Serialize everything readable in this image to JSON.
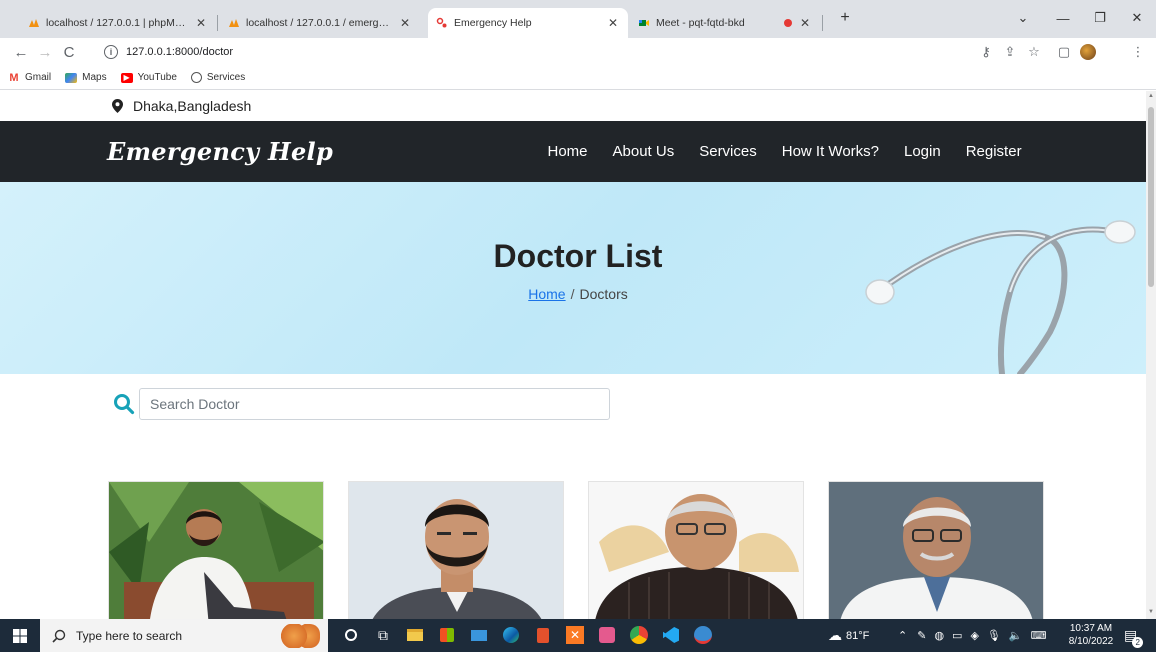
{
  "browser": {
    "tabs": [
      {
        "title": "localhost / 127.0.0.1 | phpMyAdmin",
        "active": false
      },
      {
        "title": "localhost / 127.0.0.1 / emergency",
        "active": false
      },
      {
        "title": "Emergency Help",
        "active": true
      },
      {
        "title": "Meet - pqt-fqtd-bkd",
        "active": false
      }
    ],
    "url": "127.0.0.1:8000/doctor",
    "bookmarks": [
      "Gmail",
      "Maps",
      "YouTube",
      "Services"
    ]
  },
  "page": {
    "location": "Dhaka,Bangladesh",
    "brand": "Emergency Help",
    "nav": [
      "Home",
      "About Us",
      "Services",
      "How It Works?",
      "Login",
      "Register"
    ],
    "hero": {
      "title": "Doctor List",
      "breadcrumb_home": "Home",
      "breadcrumb_separator": "/",
      "breadcrumb_current": "Doctors"
    },
    "search": {
      "placeholder": "Search Doctor",
      "value": ""
    },
    "doctor_cards": 4
  },
  "taskbar": {
    "search_placeholder": "Type here to search",
    "weather": "81°F",
    "time": "10:37 AM",
    "date": "8/10/2022",
    "notifications": "2"
  },
  "colors": {
    "navbar": "#212529",
    "hero": "#c5ebf9",
    "accent": "#17a2b8",
    "link": "#1a73e8",
    "taskbar": "#1d2b3a"
  }
}
